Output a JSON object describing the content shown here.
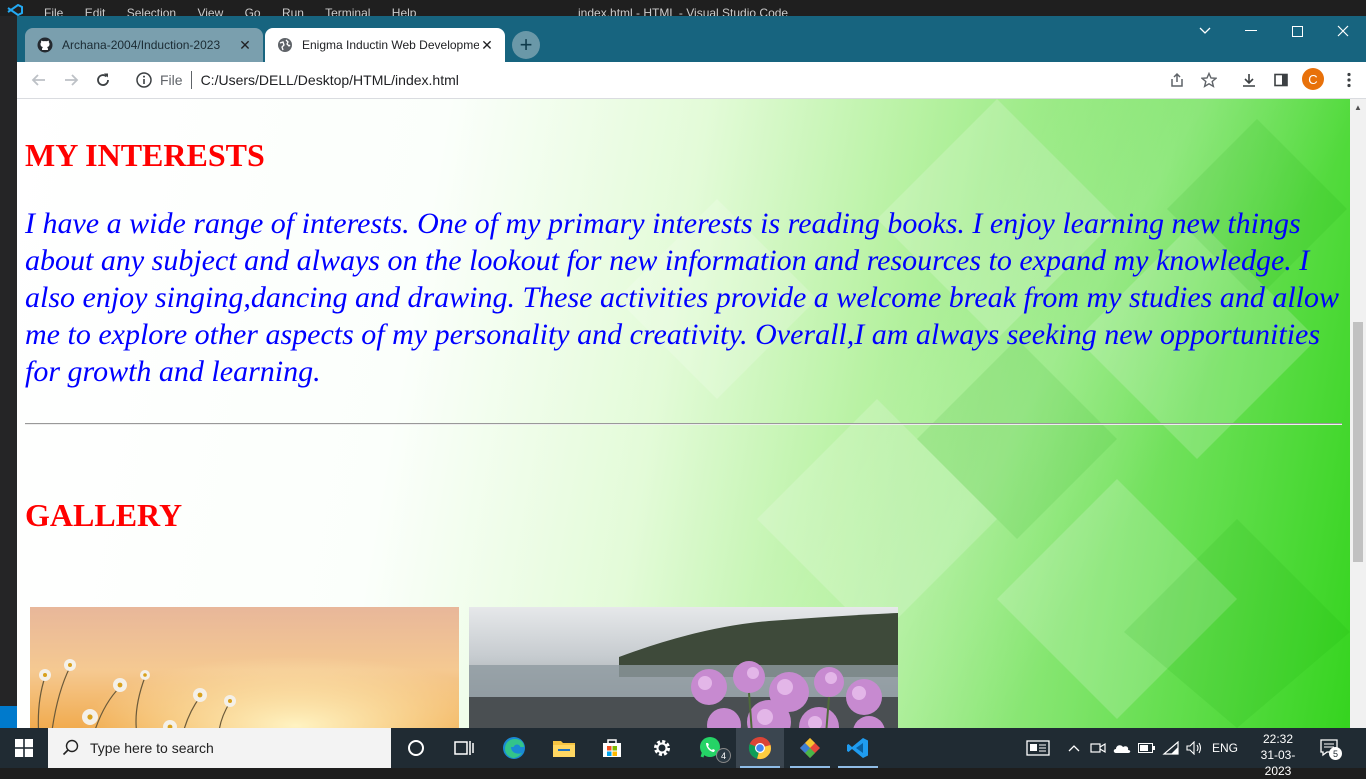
{
  "vscode": {
    "menu": [
      "File",
      "Edit",
      "Selection",
      "View",
      "Go",
      "Run",
      "Terminal",
      "Help"
    ],
    "title": "index.html - HTML - Visual Studio Code"
  },
  "browser": {
    "tabs": [
      {
        "title": "Archana-2004/Induction-2023",
        "icon": "github-icon"
      },
      {
        "title": "Enigma Inductin Web Developme",
        "icon": "globe-icon",
        "active": true
      }
    ],
    "scheme": "File",
    "url": "C:/Users/DELL/Desktop/HTML/index.html",
    "avatar_letter": "C"
  },
  "page": {
    "interests_heading": "MY INTERESTS",
    "interests_text": "I have a wide range of interests. One of my primary interests is reading books. I enjoy learning new things about any subject and always on the lookout for new information and resources to expand my knowledge. I also enjoy singing,dancing and drawing. These activities provide a welcome break from my studies and allow me to explore other aspects of my personality and creativity. Overall,I am always seeking new opportunities for growth and learning.",
    "gallery_heading": "GALLERY"
  },
  "taskbar": {
    "search_placeholder": "Type here to search",
    "whatsapp_badge": "4",
    "language": "ENG",
    "time": "22:32",
    "date": "31-03-2023",
    "notification_count": "5"
  },
  "colors": {
    "heading": "#ff0000",
    "body_text": "#0000ff",
    "tabstrip": "#17647f"
  }
}
